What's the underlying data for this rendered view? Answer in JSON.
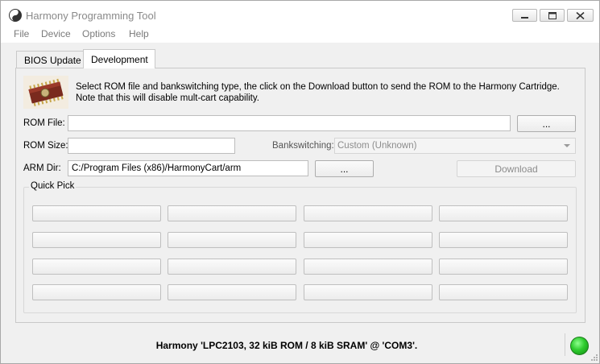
{
  "window": {
    "title": "Harmony Programming Tool"
  },
  "menu": {
    "items": [
      "File",
      "Device",
      "Options",
      "Help"
    ]
  },
  "tabs": [
    {
      "label": "BIOS Update",
      "active": false
    },
    {
      "label": "Development",
      "active": true
    }
  ],
  "development": {
    "description": "Select ROM file and bankswitching type, the click on the Download button to send the ROM to the Harmony Cartridge.  Note that this will disable mult-cart capability.",
    "rom_file_label": "ROM File:",
    "rom_file_value": "",
    "rom_browse_label": "...",
    "rom_size_label": "ROM Size:",
    "rom_size_value": "",
    "bankswitching_label": "Bankswitching:",
    "bankswitching_value": "Custom (Unknown)",
    "arm_dir_label": "ARM Dir:",
    "arm_dir_value": "C:/Program Files (x86)/HarmonyCart/arm",
    "arm_browse_label": "...",
    "download_label": "Download",
    "quick_pick_label": "Quick Pick",
    "quick_pick_buttons": [
      "",
      "",
      "",
      "",
      "",
      "",
      "",
      "",
      "",
      "",
      "",
      "",
      "",
      "",
      "",
      ""
    ]
  },
  "status": {
    "text": "Harmony 'LPC2103, 32 kiB ROM / 8 kiB SRAM' @ 'COM3'.",
    "led_color": "#2fcc2f"
  }
}
